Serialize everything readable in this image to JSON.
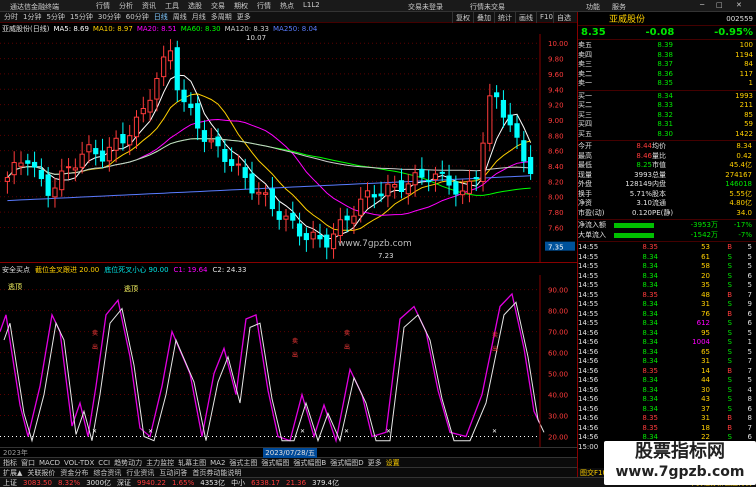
{
  "titlebar": {
    "app_title": "通达信金融终端",
    "menu": [
      "行情",
      "分析",
      "资讯",
      "工具",
      "选股",
      "交易",
      "期权",
      "行情",
      "热点",
      "L1L2"
    ],
    "center": "交易未登录",
    "center2": "行情未交易",
    "right": [
      "功能",
      "服务"
    ],
    "time": "..."
  },
  "period_buttons": [
    "分时",
    "1分钟",
    "5分钟",
    "15分钟",
    "30分钟",
    "60分钟",
    "日线",
    "周线",
    "月线",
    "多周期",
    "更多"
  ],
  "selected_period": "日线",
  "toolbar_right": [
    "复权",
    "叠加",
    "统计",
    "画线",
    "F10",
    "自选"
  ],
  "legend1": {
    "name": "亚威股份(日线)",
    "ma": [
      {
        "label": "MA5: 8.69",
        "color": "#ffffff"
      },
      {
        "label": "MA10: 8.97",
        "color": "#ffd000"
      },
      {
        "label": "MA20: 8.51",
        "color": "#ff00ff"
      },
      {
        "label": "MA60: 8.30",
        "color": "#00ff00"
      },
      {
        "label": "MA120: 8.33",
        "color": "#cccccc"
      },
      {
        "label": "MA250: 8.04",
        "color": "#5a7cff"
      }
    ]
  },
  "price_axis": [
    "10.00",
    "9.80",
    "9.60",
    "9.40",
    "9.20",
    "9.00",
    "8.80",
    "8.60",
    "8.40",
    "8.20",
    "8.00",
    "7.80",
    "7.60",
    "7.35"
  ],
  "annotations": {
    "high": "10.07",
    "low": "7.23",
    "watermark": "www.7gpzb.com"
  },
  "legend2": {
    "name": "安全买点",
    "p1": "截位金叉跟进 20.00",
    "p2": "底位死叉小心 90.00",
    "c1": "C1: 19.64",
    "c2": "C2: 24.33"
  },
  "osc_axis": [
    "90.00",
    "80.00",
    "70.00",
    "60.00",
    "50.00",
    "40.00",
    "30.00",
    "20.00"
  ],
  "osc_labels": {
    "sell1": "逃顶",
    "sell2": "逃顶",
    "vert": [
      "卖",
      "出"
    ]
  },
  "date_label": "2023/07/28/五",
  "year_label": "2023年",
  "bottom_tabs": [
    "指标",
    "窗口",
    "MACD",
    "VOL-TDX",
    "CCI",
    "趋势动力",
    "主力监控",
    "轧幕主图",
    "MA2",
    "强式主图",
    "强式幅图",
    "强式幅图B",
    "强式幅图D",
    "更多",
    "设置"
  ],
  "bottom_tabs2": [
    "扩展▲",
    "关联报价",
    "资金分布",
    "综合资讯",
    "行业资讯",
    "互动问答",
    "首页券动能说明"
  ],
  "status": {
    "sh": "上证",
    "sh_val": "3083.50",
    "sh_chg": "8.32%",
    "sh_amt": "3000亿",
    "sz": "深证",
    "sz_val": "9940.22",
    "sz_chg": "1.65%",
    "sz_amt": "4353亿",
    "zx": "中小",
    "zx_val": "6338.17",
    "zx_chg": "21.36",
    "zx_amt": "379.4亿",
    "right": "平安证券新疆运行情"
  },
  "quote": {
    "name": "亚威股份",
    "code": "002559",
    "price": "8.35",
    "change": "-0.08",
    "pct": "-0.95%",
    "asks": [
      [
        "卖五",
        "8.39",
        "100"
      ],
      [
        "卖四",
        "8.38",
        "1194"
      ],
      [
        "卖三",
        "8.37",
        "84"
      ],
      [
        "卖二",
        "8.36",
        "117"
      ],
      [
        "卖一",
        "8.35",
        "1"
      ]
    ],
    "bids": [
      [
        "买一",
        "8.34",
        "1993"
      ],
      [
        "买二",
        "8.33",
        "211"
      ],
      [
        "买三",
        "8.32",
        "85"
      ],
      [
        "买四",
        "8.31",
        "59"
      ],
      [
        "买五",
        "8.30",
        "1422"
      ]
    ],
    "stats": [
      [
        "今开",
        "8.44",
        "均价",
        "8.34"
      ],
      [
        "最高",
        "8.46",
        "量比",
        "0.42"
      ],
      [
        "最低",
        "8.25",
        "市值",
        "45.4亿"
      ],
      [
        "现量",
        "3993",
        "总量",
        "274167"
      ],
      [
        "外盘",
        "128149",
        "内盘",
        "146018"
      ],
      [
        "换手",
        "5.71%",
        "股本",
        "5.55亿"
      ],
      [
        "净资",
        "3.10",
        "流通",
        "4.80亿"
      ],
      [
        "市盈(动)",
        "0.120",
        "PE(静)",
        "34.0"
      ]
    ],
    "flows": [
      [
        "净流入额",
        "-3953万",
        "-17%"
      ],
      [
        "大单流入",
        "-1542万",
        "-7%"
      ]
    ],
    "ticks": [
      [
        "14:55",
        "8.35",
        "53",
        "B",
        "5"
      ],
      [
        "14:55",
        "8.34",
        "61",
        "S",
        "5"
      ],
      [
        "14:55",
        "8.34",
        "58",
        "S",
        "5"
      ],
      [
        "14:55",
        "8.34",
        "20",
        "S",
        "6"
      ],
      [
        "14:55",
        "8.34",
        "35",
        "S",
        "5"
      ],
      [
        "14:55",
        "8.35",
        "48",
        "B",
        "7"
      ],
      [
        "14:55",
        "8.34",
        "31",
        "S",
        "9"
      ],
      [
        "14:55",
        "8.34",
        "76",
        "B",
        "6"
      ],
      [
        "14:55",
        "8.34",
        "612",
        "S",
        "6"
      ],
      [
        "14:56",
        "8.34",
        "95",
        "S",
        "5"
      ],
      [
        "14:56",
        "8.34",
        "1004",
        "S",
        "1"
      ],
      [
        "14:56",
        "8.34",
        "65",
        "S",
        "5"
      ],
      [
        "14:56",
        "8.34",
        "31",
        "S",
        "7"
      ],
      [
        "14:56",
        "8.35",
        "14",
        "B",
        "7"
      ],
      [
        "14:56",
        "8.34",
        "44",
        "S",
        "5"
      ],
      [
        "14:56",
        "8.34",
        "30",
        "S",
        "4"
      ],
      [
        "14:56",
        "8.34",
        "43",
        "S",
        "8"
      ],
      [
        "14:56",
        "8.34",
        "37",
        "S",
        "6"
      ],
      [
        "14:56",
        "8.35",
        "31",
        "B",
        "8"
      ],
      [
        "14:56",
        "8.35",
        "18",
        "B",
        "7"
      ],
      [
        "14:56",
        "8.34",
        "22",
        "S",
        "6"
      ],
      [
        "15:00",
        "8.35",
        "3993",
        "B",
        "3"
      ]
    ],
    "footer": "图交F10 到数据"
  },
  "colors": {
    "up": "#ff3b3b",
    "down": "#00ffff",
    "bg": "#000000",
    "grid": "#5a0000"
  }
}
